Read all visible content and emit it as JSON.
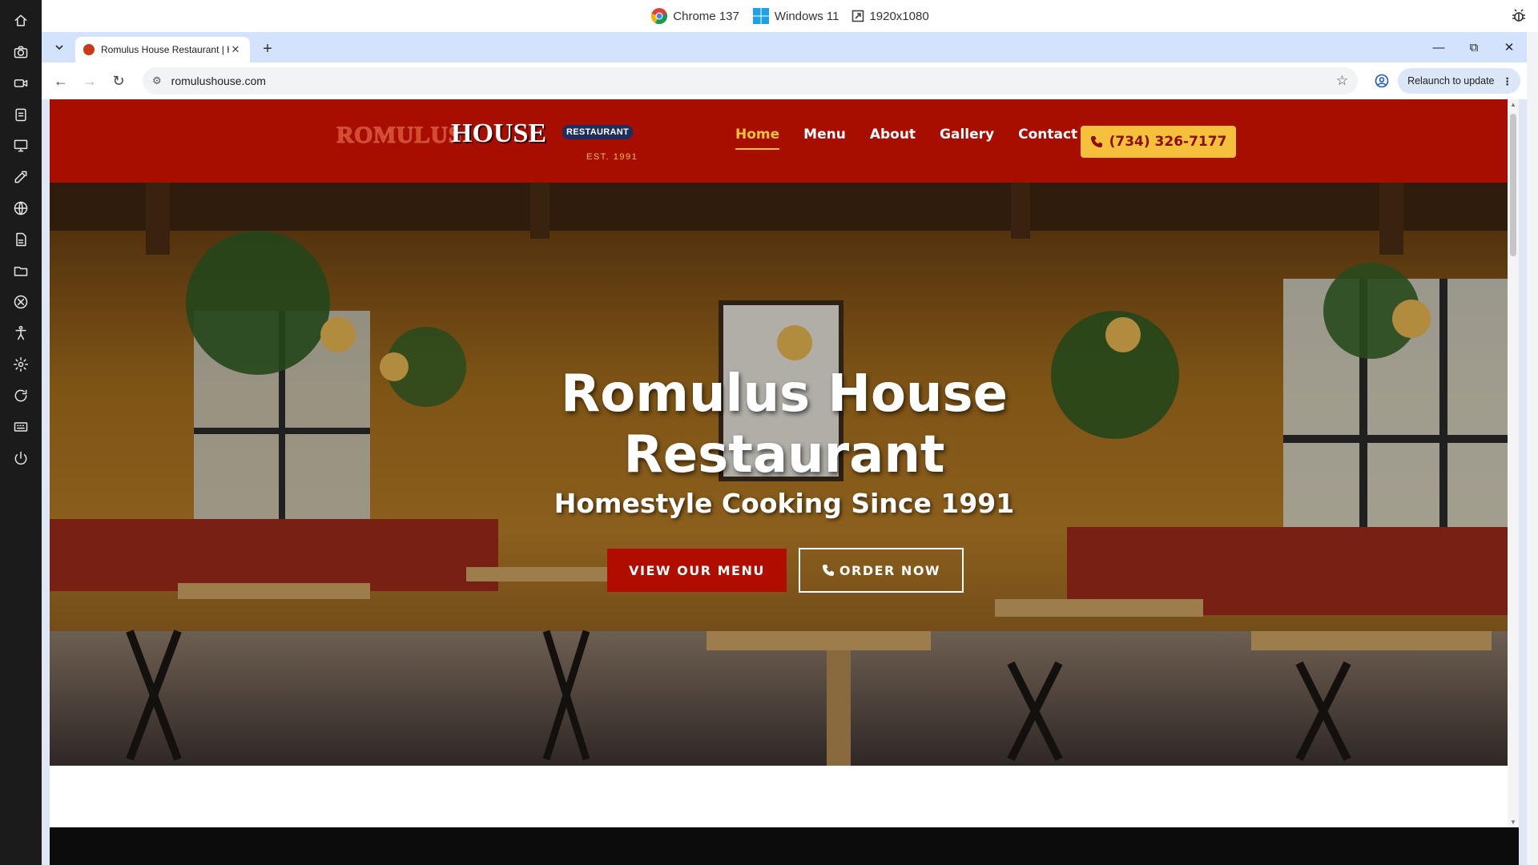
{
  "env": {
    "browser": "Chrome 137",
    "os": "Windows 11",
    "resolution": "1920x1080"
  },
  "sidebar": {
    "icons": [
      "home-icon",
      "camera-icon",
      "video-icon",
      "clipboard-icon",
      "monitor-icon",
      "edit-icon",
      "globe-icon",
      "file-icon",
      "folder-icon",
      "network-icon",
      "accessibility-icon",
      "settings-icon",
      "refresh-icon",
      "keyboard-icon",
      "power-icon"
    ]
  },
  "browser": {
    "tab_title": "Romulus House Restaurant | Ho",
    "tab_close": "✕",
    "new_tab": "+",
    "url": "romulushouse.com",
    "relaunch_label": "Relaunch to update"
  },
  "site": {
    "logo": {
      "word1": "ROMULUS",
      "word2": "HOUSE",
      "badge": "RESTAURANT",
      "est": "EST. 1991"
    },
    "nav": {
      "home": "Home",
      "menu": "Menu",
      "about": "About",
      "gallery": "Gallery",
      "contact": "Contact"
    },
    "phone_button": "(734) 326-7177",
    "hero": {
      "title_line1": "Romulus House",
      "title_line2": "Restaurant",
      "subtitle": "Homestyle Cooking Since 1991",
      "btn_menu": "VIEW OUR MENU",
      "btn_order": "ORDER NOW"
    }
  },
  "colors": {
    "brand_red": "#a80e00",
    "accent_gold": "#f5c03c"
  }
}
